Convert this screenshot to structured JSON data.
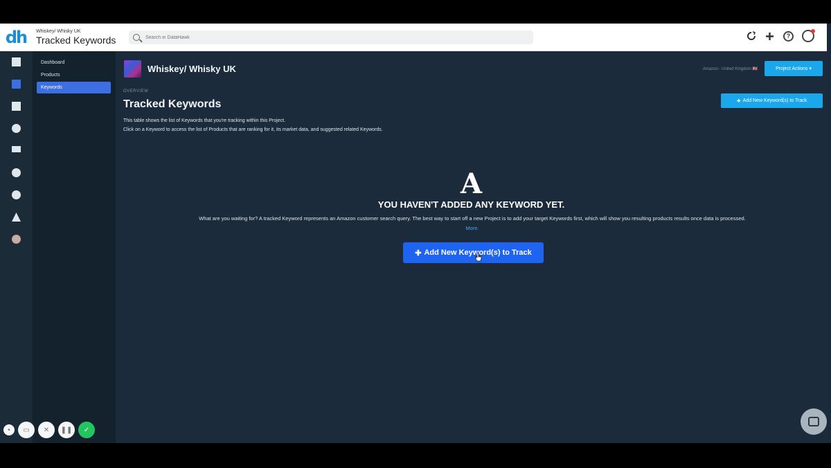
{
  "header": {
    "logo": "dh",
    "project_crumb": "Whiskey/ Whisky UK",
    "page_title": "Tracked Keywords",
    "search_placeholder": "Search in DataHawk",
    "icons": [
      "refresh-icon",
      "plus-icon",
      "help-icon",
      "user-avatar-icon"
    ]
  },
  "rail": {
    "icons": [
      "dashboard-icon",
      "projects-icon",
      "ads-icon",
      "analytics-icon",
      "keywords-icon",
      "revenue-icon",
      "sync-icon",
      "groups-icon",
      "marketplace-icon"
    ]
  },
  "sidenav": {
    "items": [
      {
        "label": "Dashboard",
        "active": false
      },
      {
        "label": "Products",
        "active": false
      },
      {
        "label": "Keywords",
        "active": true
      }
    ]
  },
  "main": {
    "project_name": "Whiskey/ Whisky UK",
    "project_meta": "Amazon - United Kingdom 🇬🇧",
    "project_actions_label": "Project Actions ▾",
    "section_label": "OVERVIEW",
    "title": "Tracked Keywords",
    "description_line1": "This table shows the list of Keywords that you're tracking within this Project.",
    "description_line2": "Click on a Keyword to access the list of Products that are ranking for it, its market data, and suggested related Keywords.",
    "add_top_label": "Add New Keyword(s) to Track",
    "empty_icon": "A",
    "empty_title": "YOU HAVEN'T ADDED ANY KEYWORD YET.",
    "empty_text": "What are you waiting for? A tracked Keyword represents an Amazon customer search query. The best way to start off a new Project is to add your target Keywords first, which will show you resulting products results once data is processed.",
    "more_link": "More.",
    "add_main_label": "Add New Keyword(s) to Track"
  },
  "colors": {
    "accent": "#1aa7ec",
    "primary_button": "#1f64f0",
    "nav_active": "#3d6fe3",
    "background": "#1c2b3b"
  }
}
